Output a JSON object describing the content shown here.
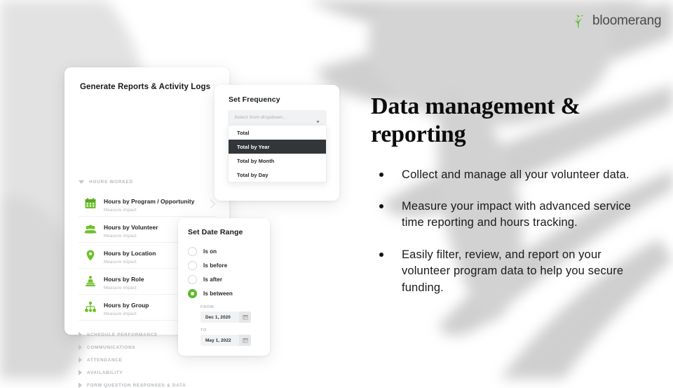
{
  "brand": {
    "logo_text": "bloomerang",
    "logo_icon": "leaf-sprout-icon",
    "green": "#5cba28",
    "logo_gray": "#4a4a4a"
  },
  "copy": {
    "headline": "Data management & reporting",
    "bullets": [
      "Collect and manage all your volunteer data.",
      "Measure your impact with advanced service time reporting and hours tracking.",
      "Easily filter, review, and report on your volunteer program data to help you secure funding."
    ]
  },
  "reports_card": {
    "title": "Generate Reports & Activity Logs",
    "expanded_section": "HOURS WORKED",
    "rows": [
      {
        "name": "Hours by Program / Opportunity",
        "sub": "Measure impact",
        "icon": "calendar-icon"
      },
      {
        "name": "Hours by Volunteer",
        "sub": "Measure impact",
        "icon": "people-group-icon"
      },
      {
        "name": "Hours by Location",
        "sub": "Measure impact",
        "icon": "location-pin-icon"
      },
      {
        "name": "Hours by Role",
        "sub": "Measure impact",
        "icon": "badge-person-icon"
      },
      {
        "name": "Hours by Group",
        "sub": "Measure impact",
        "icon": "org-chart-icon"
      }
    ],
    "collapsed_sections": [
      "SCHEDULE PERFORMANCE",
      "COMMUNICATIONS",
      "ATTENDANCE",
      "AVAILABILITY",
      "FORM QUESTION RESPONSES & DATA"
    ]
  },
  "frequency_card": {
    "title": "Set Frequency",
    "select_placeholder": "Select from dropdown...",
    "options": [
      "Total",
      "Total by Year",
      "Total by Month",
      "Total by Day"
    ],
    "selected_option": "Total by Year",
    "highlight_color": "#333639"
  },
  "daterange_card": {
    "title": "Set Date Range",
    "options": [
      "Is on",
      "Is before",
      "Is after",
      "Is between"
    ],
    "selected_option": "Is between",
    "from_label": "FROM",
    "from_value": "Dec 1, 2020",
    "to_label": "TO",
    "to_value": "May 1, 2022"
  }
}
